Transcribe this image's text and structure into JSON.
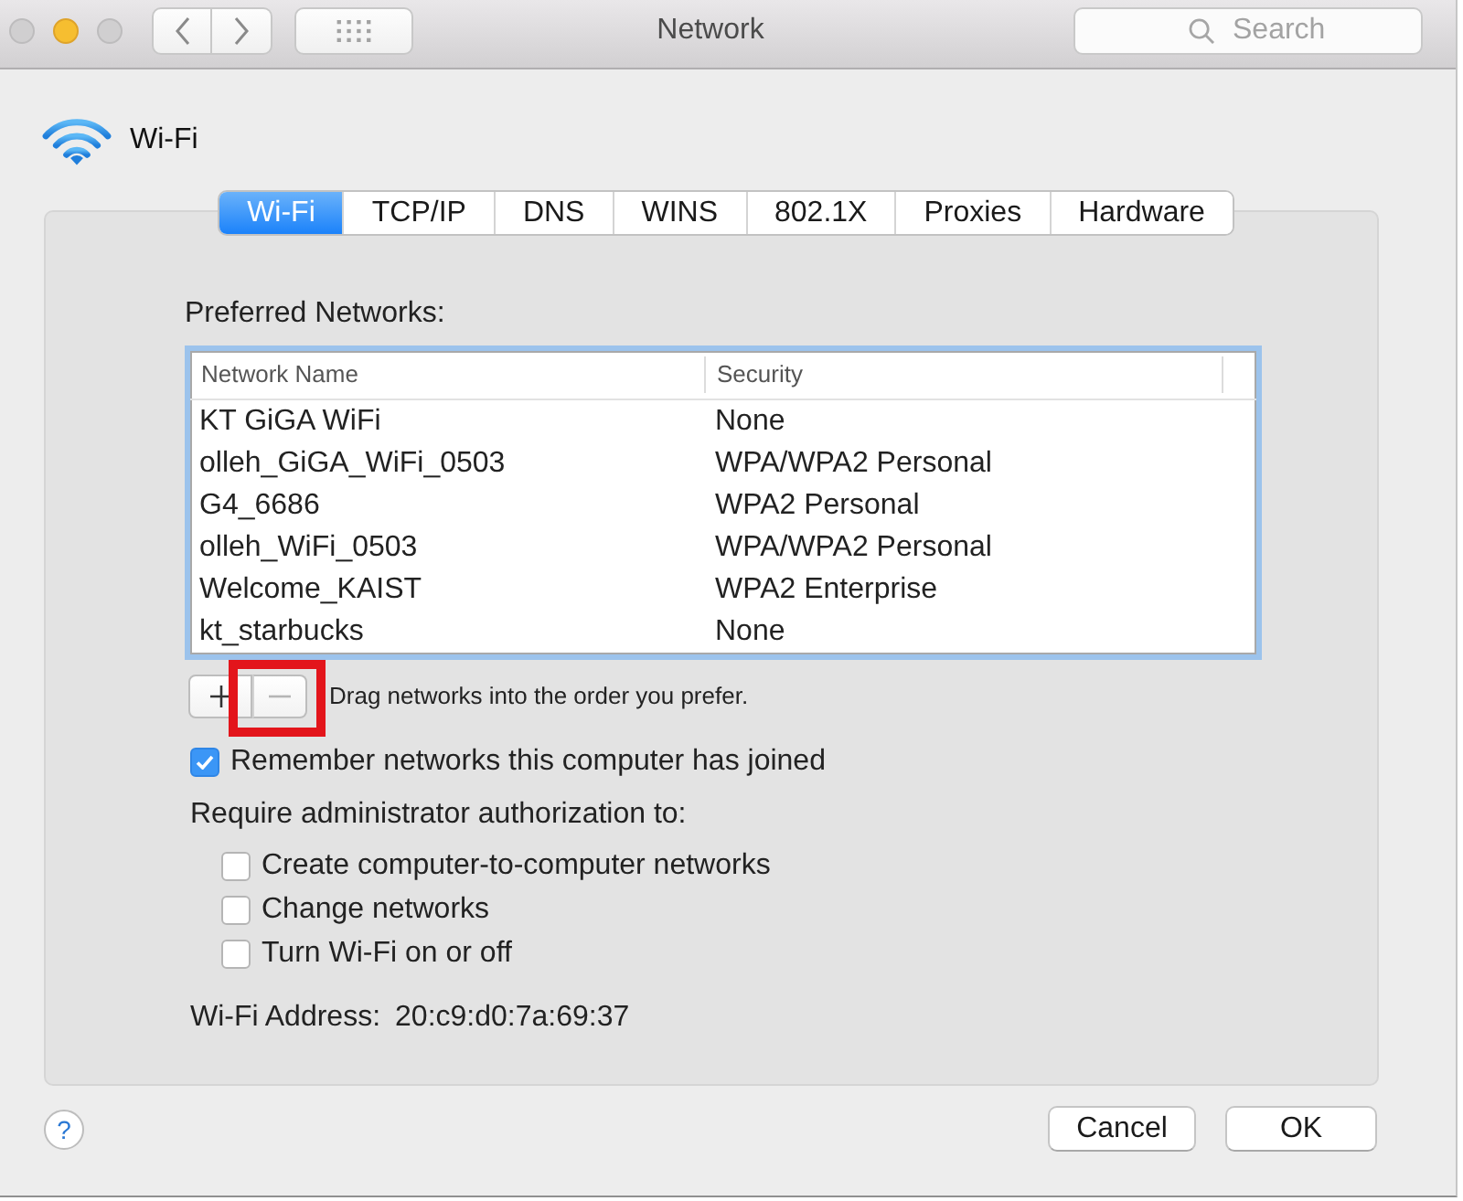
{
  "window": {
    "title": "Network",
    "controls": [
      {
        "kind": "close",
        "disabled": true
      },
      {
        "kind": "minimize",
        "disabled": false
      },
      {
        "kind": "zoom",
        "disabled": true
      }
    ],
    "search": {
      "placeholder": "Search"
    }
  },
  "service": {
    "name": "Wi-Fi"
  },
  "tabs": [
    {
      "label": "Wi-Fi",
      "selected": true
    },
    {
      "label": "TCP/IP",
      "selected": false
    },
    {
      "label": "DNS",
      "selected": false
    },
    {
      "label": "WINS",
      "selected": false
    },
    {
      "label": "802.1X",
      "selected": false
    },
    {
      "label": "Proxies",
      "selected": false
    },
    {
      "label": "Hardware",
      "selected": false
    }
  ],
  "preferred_networks": {
    "label": "Preferred Networks:",
    "columns": [
      "Network Name",
      "Security"
    ],
    "rows": [
      {
        "network_name": "KT GiGA WiFi",
        "security": "None",
        "selected": false
      },
      {
        "network_name": "olleh_GiGA_WiFi_0503",
        "security": "WPA/WPA2 Personal",
        "selected": false
      },
      {
        "network_name": "G4_6686",
        "security": "WPA2 Personal",
        "selected": false
      },
      {
        "network_name": "olleh_WiFi_0503",
        "security": "WPA/WPA2 Personal",
        "selected": false
      },
      {
        "network_name": "Welcome_KAIST",
        "security": "WPA2 Enterprise",
        "selected": false
      },
      {
        "network_name": "kt_starbucks",
        "security": "None",
        "selected": false
      }
    ]
  },
  "list_buttons": [
    {
      "kind": "add",
      "disabled": false,
      "highlighted": false
    },
    {
      "kind": "remove",
      "disabled": true,
      "highlighted": true
    }
  ],
  "list_hint": "Drag networks into the order you prefer.",
  "remember_networks": {
    "label": "Remember networks this computer has joined",
    "checked": true
  },
  "admin_authorization": {
    "label": "Require administrator authorization to:",
    "options": [
      {
        "label": "Create computer-to-computer networks",
        "checked": false
      },
      {
        "label": "Change networks",
        "checked": false
      },
      {
        "label": "Turn Wi-Fi on or off",
        "checked": false
      }
    ]
  },
  "wifi_address": {
    "label": "Wi-Fi Address:",
    "value": "20:c9:d0:7a:69:37"
  },
  "help": {
    "label": "?"
  },
  "buttons": [
    {
      "kind": "cancel",
      "label": "Cancel"
    },
    {
      "kind": "confirm",
      "label": "OK"
    }
  ]
}
